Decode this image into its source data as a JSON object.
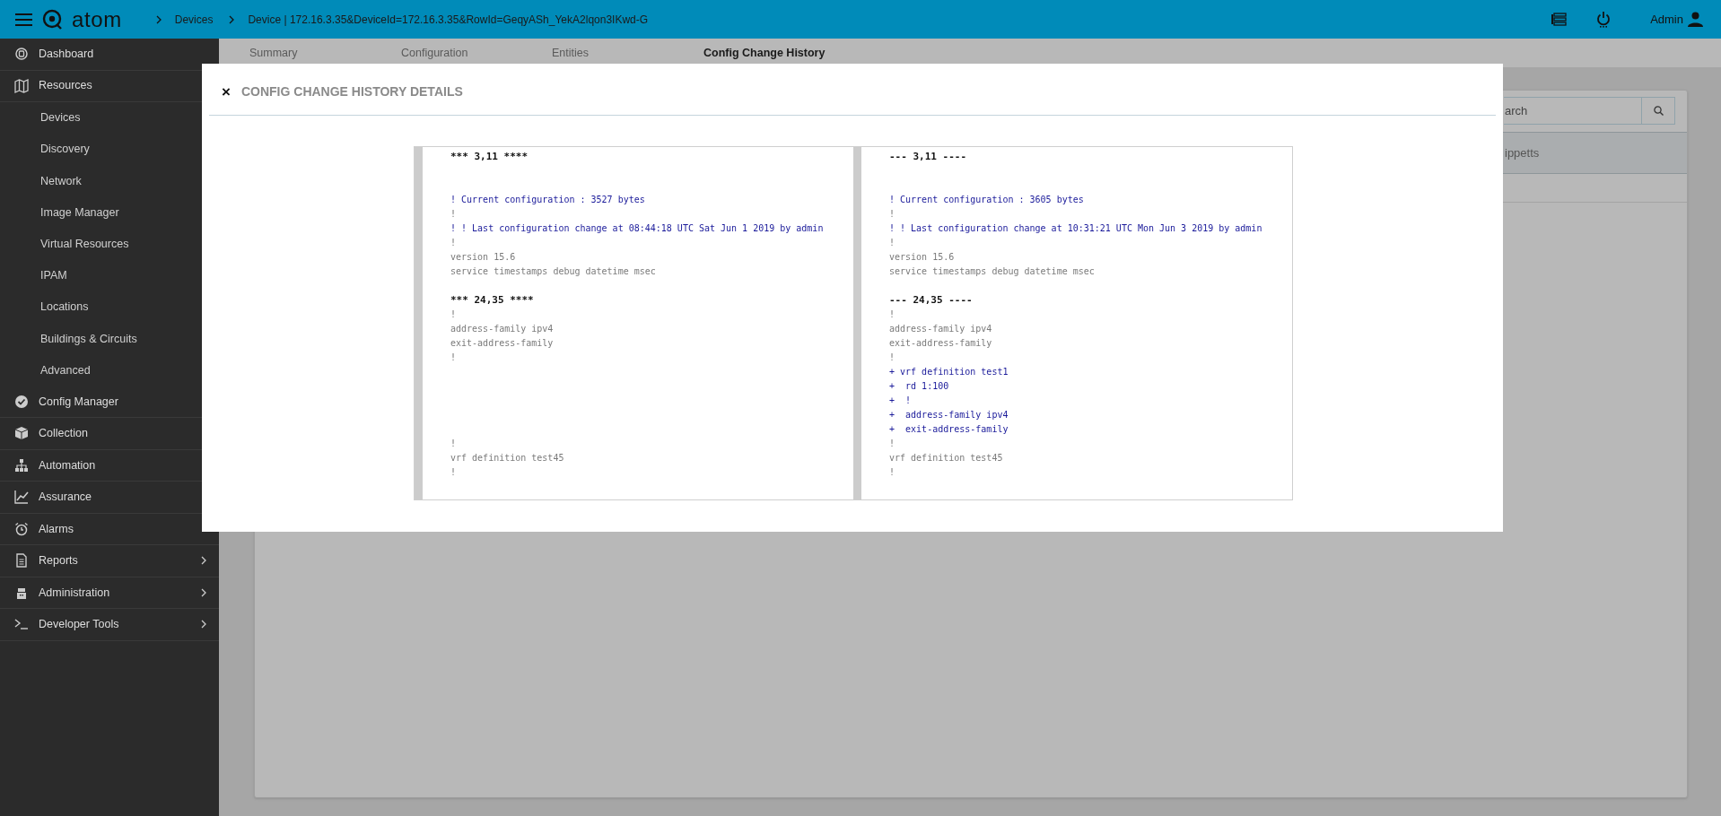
{
  "top_bar": {
    "logo": "atom",
    "breadcrumbs": [
      {
        "label": "Devices"
      },
      {
        "label": "Device | 172.16.3.35&DeviceId=172.16.3.35&RowId=GeqyASh_YekA2lqon3IKwd-G"
      }
    ],
    "user": "Admin"
  },
  "sidebar": {
    "items": [
      {
        "label": "Dashboard",
        "chevron": false
      },
      {
        "label": "Resources",
        "chevron": false,
        "children": [
          {
            "label": "Devices"
          },
          {
            "label": "Discovery"
          },
          {
            "label": "Network"
          },
          {
            "label": "Image Manager"
          },
          {
            "label": "Virtual Resources"
          },
          {
            "label": "IPAM"
          },
          {
            "label": "Locations"
          },
          {
            "label": "Buildings & Circuits"
          },
          {
            "label": "Advanced"
          }
        ]
      },
      {
        "label": "Config Manager",
        "chevron": false
      },
      {
        "label": "Collection",
        "chevron": false
      },
      {
        "label": "Automation",
        "chevron": false
      },
      {
        "label": "Assurance",
        "chevron": false
      },
      {
        "label": "Alarms",
        "chevron": false
      },
      {
        "label": "Reports",
        "chevron": true
      },
      {
        "label": "Administration",
        "chevron": true
      },
      {
        "label": "Developer Tools",
        "chevron": true
      }
    ]
  },
  "tabs": [
    {
      "label": "Summary",
      "selected": false
    },
    {
      "label": "Configuration",
      "selected": false
    },
    {
      "label": "Entities",
      "selected": false
    },
    {
      "label": "Config Change History",
      "selected": true
    }
  ],
  "background_card": {
    "search_text": "arch",
    "row_text": "ippetts"
  },
  "modal": {
    "title": "CONFIG CHANGE HISTORY DETAILS",
    "close": "×",
    "panes": [
      {
        "lines": [
          {
            "kind": "header",
            "text": "*** 3,11 ****"
          },
          {
            "kind": "blank"
          },
          {
            "kind": "blank"
          },
          {
            "kind": "comment",
            "text": "! Current configuration : 3527 bytes"
          },
          {
            "kind": "plain",
            "text": "!"
          },
          {
            "kind": "comment",
            "text": "! ! Last configuration change at 08:44:18 UTC Sat Jun 1 2019 by admin"
          },
          {
            "kind": "plain",
            "text": "!"
          },
          {
            "kind": "plain",
            "text": "version 15.6"
          },
          {
            "kind": "plain",
            "text": "service timestamps debug datetime msec"
          },
          {
            "kind": "blank"
          },
          {
            "kind": "header",
            "text": "*** 24,35 ****"
          },
          {
            "kind": "plain",
            "text": "!"
          },
          {
            "kind": "plain",
            "text": "address-family ipv4"
          },
          {
            "kind": "plain",
            "text": "exit-address-family"
          },
          {
            "kind": "plain",
            "text": "!"
          },
          {
            "kind": "blank"
          },
          {
            "kind": "blank"
          },
          {
            "kind": "blank"
          },
          {
            "kind": "blank"
          },
          {
            "kind": "blank"
          },
          {
            "kind": "plain",
            "text": "!"
          },
          {
            "kind": "plain",
            "text": "vrf definition test45"
          },
          {
            "kind": "plain",
            "text": "!"
          }
        ]
      },
      {
        "lines": [
          {
            "kind": "header",
            "text": "--- 3,11 ----"
          },
          {
            "kind": "blank"
          },
          {
            "kind": "blank"
          },
          {
            "kind": "comment",
            "text": "! Current configuration : 3605 bytes"
          },
          {
            "kind": "plain",
            "text": "!"
          },
          {
            "kind": "comment",
            "text": "! ! Last configuration change at 10:31:21 UTC Mon Jun 3 2019 by admin"
          },
          {
            "kind": "plain",
            "text": "!"
          },
          {
            "kind": "plain",
            "text": "version 15.6"
          },
          {
            "kind": "plain",
            "text": "service timestamps debug datetime msec"
          },
          {
            "kind": "blank"
          },
          {
            "kind": "header",
            "text": "--- 24,35 ----"
          },
          {
            "kind": "plain",
            "text": "!"
          },
          {
            "kind": "plain",
            "text": "address-family ipv4"
          },
          {
            "kind": "plain",
            "text": "exit-address-family"
          },
          {
            "kind": "plain",
            "text": "!"
          },
          {
            "kind": "added",
            "text": "+ vrf definition test1"
          },
          {
            "kind": "added",
            "text": "+  rd 1:100"
          },
          {
            "kind": "added",
            "text": "+  !"
          },
          {
            "kind": "added",
            "text": "+  address-family ipv4"
          },
          {
            "kind": "added",
            "text": "+  exit-address-family"
          },
          {
            "kind": "plain",
            "text": "!"
          },
          {
            "kind": "plain",
            "text": "vrf definition test45"
          },
          {
            "kind": "plain",
            "text": "!"
          }
        ]
      }
    ]
  }
}
